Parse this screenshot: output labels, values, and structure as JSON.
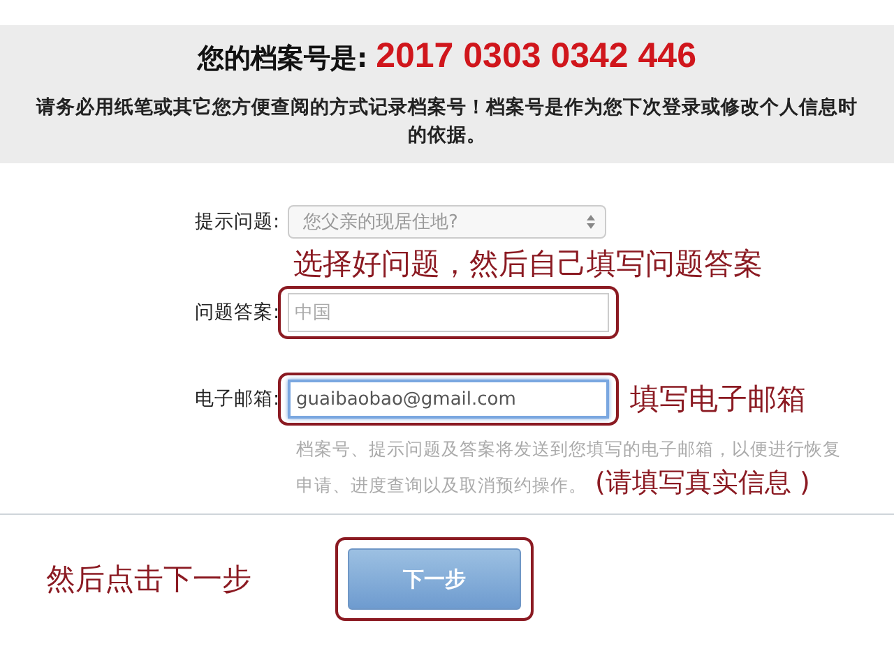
{
  "archive": {
    "label": "您的档案号是:",
    "number": "2017 0303 0342 446",
    "notice": "请务必用纸笔或其它您方便查阅的方式记录档案号！档案号是作为您下次登录或修改个人信息时的依据。"
  },
  "question": {
    "label": "提示问题:",
    "value": "您父亲的现居住地?"
  },
  "question_note": "选择好问题，然后自己填写问题答案",
  "answer": {
    "label": "问题答案:",
    "placeholder": "中国",
    "annotated": true
  },
  "email": {
    "label": "电子邮箱:",
    "value": "guaibaobao@gmail.com",
    "focused": true,
    "annotated": true,
    "note": "填写电子邮箱",
    "hint_lines": [
      "档案号、提示问题及答案将发送到您填写的电子邮箱，以便进行恢复",
      "申请、进度查询以及取消预约操作。"
    ],
    "hint_note": "(请填写真实信息 )"
  },
  "next": {
    "note": "然后点击下一步",
    "button": "下一步",
    "annotated": true
  }
}
